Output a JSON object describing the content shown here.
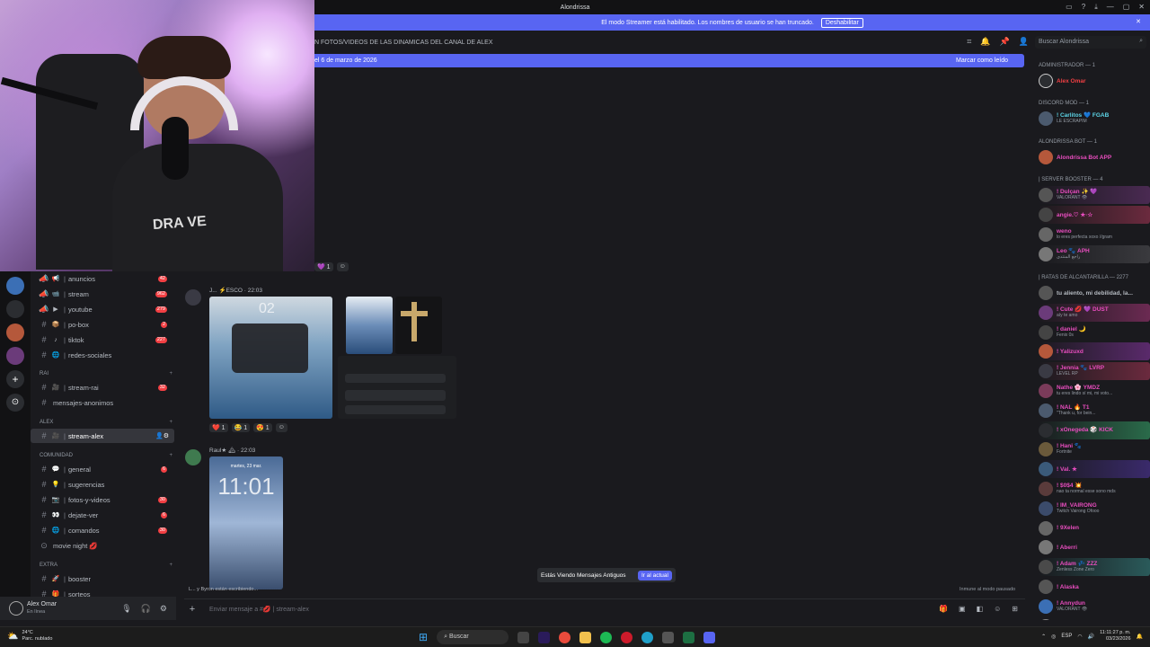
{
  "titlebar": {
    "title": "Alondrissa"
  },
  "streamer": {
    "message": "El modo Streamer está habilitado. Los nombres de usuario se han truncado.",
    "button": "Deshabilitar"
  },
  "channel_header": {
    "topic": "N FOTOS/VIDEOS DE LAS DINAMICAS DEL CANAL DE ALEX",
    "search_placeholder": "Buscar Alondrissa"
  },
  "unread_bar": {
    "text": "el 6 de marzo de 2026",
    "action": "Marcar como leído"
  },
  "webcam": {
    "shirt_text": "DRA VE"
  },
  "channels": {
    "items": [
      {
        "name": "anuncios",
        "emoji": "📢",
        "badge": "42",
        "kind": "announce"
      },
      {
        "name": "stream",
        "emoji": "📹",
        "badge": "962",
        "kind": "announce"
      },
      {
        "name": "youtube",
        "emoji": "▶",
        "badge": "279",
        "kind": "announce"
      },
      {
        "name": "po-box",
        "emoji": "📦",
        "badge": "2",
        "kind": "text"
      },
      {
        "name": "tiktok",
        "emoji": "♪",
        "badge": "227",
        "kind": "text"
      },
      {
        "name": "redes-sociales",
        "emoji": "🌐",
        "badge": "",
        "kind": "text"
      }
    ],
    "cat_rai": "RAI",
    "rai_items": [
      {
        "name": "stream-rai",
        "emoji": "🎥",
        "badge": "32"
      },
      {
        "name": "mensajes-anonimos",
        "emoji": "",
        "badge": ""
      }
    ],
    "cat_alex": "ALEX",
    "alex_items": [
      {
        "name": "stream-alex",
        "emoji": "🎥",
        "badge": ""
      }
    ],
    "cat_comunidad": "COMUNIDAD",
    "comunidad_items": [
      {
        "name": "general",
        "emoji": "💬",
        "badge": "6"
      },
      {
        "name": "sugerencias",
        "emoji": "💡",
        "badge": ""
      },
      {
        "name": "fotos-y-videos",
        "emoji": "📷",
        "badge": "30"
      },
      {
        "name": "dejate-ver",
        "emoji": "👀",
        "badge": "6"
      },
      {
        "name": "comandos",
        "emoji": "🌐",
        "badge": "30"
      }
    ],
    "movie_night": "movie night 💋",
    "cat_extra": "EXTRA",
    "extra_items": [
      {
        "name": "booster",
        "emoji": "🚀",
        "badge": ""
      },
      {
        "name": "sorteos",
        "emoji": "🎁",
        "badge": ""
      }
    ]
  },
  "user": {
    "name": "Alex Omar",
    "status": "En línea"
  },
  "messages": {
    "msg1_author": "J... ⚡ESCO · 22:03",
    "msg1_img_number": "02",
    "msg1_reactions": [
      "❤️ 1",
      "😂 1",
      "😍 1"
    ],
    "msg2_author": "Raul★ 🏔 · 22:03",
    "msg2_img_time": "11:01",
    "msg2_img_date": "martes, 23 mar.",
    "old_msgs": "Estás Viendo Mensajes Antiguos",
    "old_button": "Ir al actual",
    "typing": "L... y Byron están escribiendo...",
    "immune": "Inmune al modo pausado",
    "top_reaction": "💜 1"
  },
  "composer": {
    "placeholder": "Enviar mensaje a #💋 | stream-alex"
  },
  "members": {
    "cat_admin": "ADMINISTRADOR — 1",
    "admin": [
      {
        "name": "Alex Omar",
        "status": "",
        "color": "#f23f43"
      }
    ],
    "cat_mod": "DISCORD MOD — 1",
    "mods": [
      {
        "name": "! Carlitos 💙 FGAB",
        "status": "LE ESCRAPIM",
        "color": "#5dd6e8"
      }
    ],
    "cat_bot": "Alondrissa Bot — 1",
    "bots": [
      {
        "name": "Alondrissa Bot APP",
        "status": "",
        "color": "#e94dbf"
      }
    ],
    "cat_booster": "| SERVER BOOSTER — 4",
    "boosters": [
      {
        "name": "! Dulçan ✨ 💜",
        "status": "VALORANT 👁",
        "color": "#e94dbf"
      },
      {
        "name": "angie.♡ ★·☆",
        "status": "",
        "color": "#e94dbf"
      },
      {
        "name": "weno",
        "status": "lo eres perfecta xoxo //gram",
        "color": "#e94dbf"
      },
      {
        "name": "Leo 🐾 APH",
        "status": "راجع المنتدى",
        "color": "#e94dbf"
      }
    ],
    "cat_ratas": "| Ratas de Alcantarilla — 2277",
    "ratas": [
      {
        "name": "tu aliento, mi debilidad, la...",
        "status": "",
        "color": "#b5bac1"
      },
      {
        "name": "! Cute 💋 💜 DUST",
        "status": "aíy te amo",
        "color": "#e94dbf"
      },
      {
        "name": "! daniel 🌙",
        "status": "Fenix 0s",
        "color": "#e94dbf"
      },
      {
        "name": "! Yalizuxd",
        "status": "",
        "color": "#e94dbf"
      },
      {
        "name": "! Jennia 🐾 LVRP",
        "status": "LEVEL RP",
        "color": "#e94dbf"
      },
      {
        "name": "Nathe 🌸 YMDZ",
        "status": "tu eres lindo sí mi, mi voto...",
        "color": "#e94dbf"
      },
      {
        "name": "! NAL 🔥 T1",
        "status": "\"Thank u, for bein...",
        "color": "#e94dbf"
      },
      {
        "name": "! xOnegeda 🎲 KICK",
        "status": "",
        "color": "#e94dbf"
      },
      {
        "name": "! Hani 🐾",
        "status": "Fortnite",
        "color": "#e94dbf"
      },
      {
        "name": "! Val. ★",
        "status": "",
        "color": "#e94dbf"
      },
      {
        "name": "! $0$4 💥",
        "status": "nao ta normal esse sono mds",
        "color": "#e94dbf"
      },
      {
        "name": "! IM_VAIRONG",
        "status": "Twitch Vairong Ofooo",
        "color": "#e94dbf"
      },
      {
        "name": "! 9Xelen",
        "status": "",
        "color": "#e94dbf"
      },
      {
        "name": "! Aberri",
        "status": "",
        "color": "#e94dbf"
      },
      {
        "name": "! Adam 💤 ZZZ",
        "status": "Zenless Zone Zero",
        "color": "#e94dbf"
      },
      {
        "name": "! Alaska",
        "status": "",
        "color": "#e94dbf"
      },
      {
        "name": "! Annydun",
        "status": "VALORANT 👁",
        "color": "#e94dbf"
      },
      {
        "name": "! baby 🐱",
        "status": "",
        "color": "#e94dbf"
      }
    ]
  },
  "taskbar": {
    "temp": "24°C",
    "weather": "Parc. nublado",
    "search": "Buscar",
    "lang": "ESP",
    "time": "11:11:27 p. m.",
    "date": "03/23/2026"
  },
  "colors": {
    "accent": "#5865f2",
    "bg": "#1a1a1e",
    "red": "#f23f43"
  }
}
